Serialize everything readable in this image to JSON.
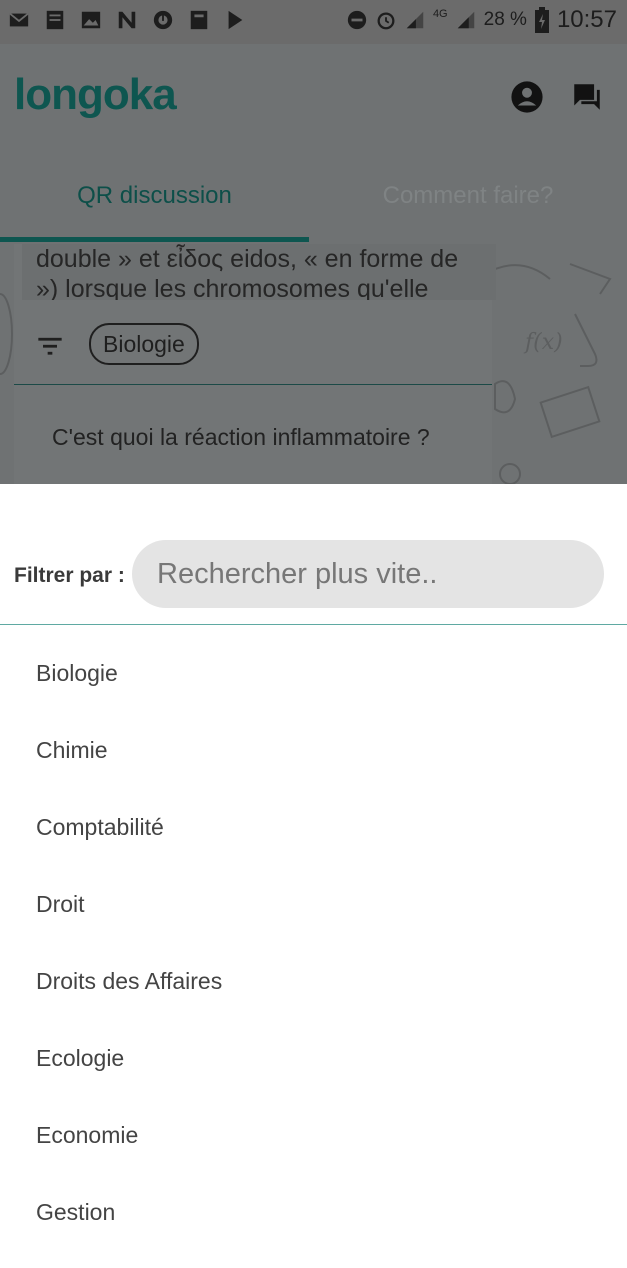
{
  "status_bar": {
    "left_icons": [
      "mail-icon",
      "app-icon",
      "image-icon",
      "n-icon",
      "notification-icon",
      "app-icon-2",
      "play-store-icon"
    ],
    "battery_percent": "28 %",
    "network": "4G",
    "time": "10:57"
  },
  "app": {
    "logo": "longoka",
    "icons": [
      "account-icon",
      "chat-icon"
    ]
  },
  "tabs": [
    {
      "label": "QR discussion",
      "active": true
    },
    {
      "label": "Comment faire?",
      "active": false
    }
  ],
  "feed": {
    "snippet_line1": "double » et εἶδος eidos, « en forme de",
    "snippet_line2": "») lorsque les chromosomes qu'elle",
    "filter_chip": "Biologie",
    "question": "C'est quoi la réaction inflammatoire ?"
  },
  "sheet": {
    "filter_label": "Filtrer par :",
    "search_placeholder": "Rechercher plus vite..",
    "search_value": "",
    "categories": [
      "Biologie",
      "Chimie",
      "Comptabilité",
      "Droit",
      "Droits des Affaires",
      "Ecologie",
      "Economie",
      "Gestion"
    ]
  },
  "colors": {
    "brand": "#0e5650",
    "overlay_bg": "#6f7273",
    "divider": "#5fa9a2",
    "search_bg": "#e4e4e4"
  }
}
